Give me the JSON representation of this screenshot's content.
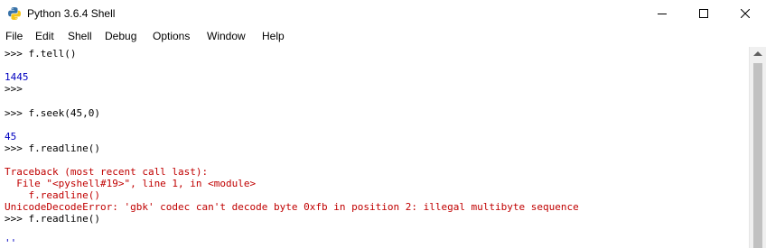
{
  "window": {
    "title": "Python 3.6.4 Shell",
    "minimize_glyph": "—",
    "maximize_glyph": "☐",
    "close_glyph": "✕"
  },
  "menu": {
    "items": [
      "File",
      "Edit",
      "Shell",
      "Debug",
      "Options",
      "Window",
      "Help"
    ]
  },
  "shell": {
    "lines": [
      {
        "prompt": ">>> ",
        "text": "f.tell()",
        "kind": "cmd"
      },
      {
        "prompt": "",
        "text": "",
        "kind": "blank"
      },
      {
        "prompt": "",
        "text": "1445",
        "kind": "out"
      },
      {
        "prompt": ">>> ",
        "text": "",
        "kind": "cmd"
      },
      {
        "prompt": "",
        "text": "",
        "kind": "blank"
      },
      {
        "prompt": ">>> ",
        "text": "f.seek(45,0)",
        "kind": "cmd"
      },
      {
        "prompt": "",
        "text": "",
        "kind": "blank"
      },
      {
        "prompt": "",
        "text": "45",
        "kind": "out"
      },
      {
        "prompt": ">>> ",
        "text": "f.readline()",
        "kind": "cmd"
      },
      {
        "prompt": "",
        "text": "",
        "kind": "blank"
      },
      {
        "prompt": "",
        "text": "Traceback (most recent call last):",
        "kind": "err"
      },
      {
        "prompt": "",
        "text": "  File \"<pyshell#19>\", line 1, in <module>",
        "kind": "err"
      },
      {
        "prompt": "",
        "text": "    f.readline()",
        "kind": "err"
      },
      {
        "prompt": "",
        "text": "UnicodeDecodeError: 'gbk' codec can't decode byte 0xfb in position 2: illegal multibyte sequence",
        "kind": "err"
      },
      {
        "prompt": ">>> ",
        "text": "f.readline()",
        "kind": "cmd"
      },
      {
        "prompt": "",
        "text": "",
        "kind": "blank"
      },
      {
        "prompt": "",
        "text": "''",
        "kind": "out"
      }
    ]
  },
  "colors": {
    "prompt": "#000000",
    "output": "#0000c0",
    "error": "#c00000"
  }
}
